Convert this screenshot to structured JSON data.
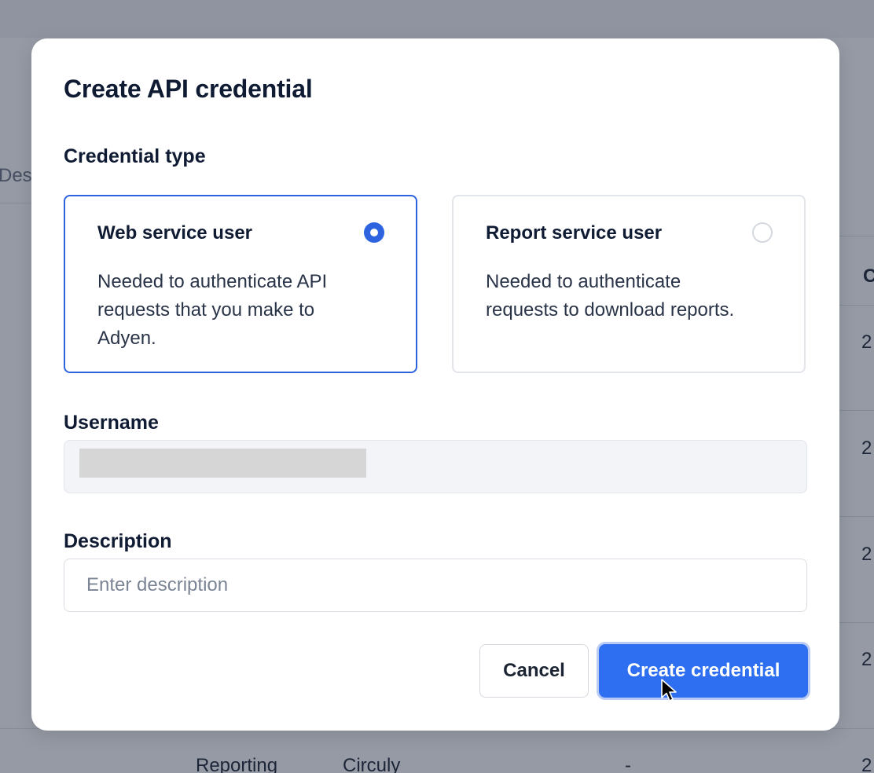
{
  "background": {
    "fragments": {
      "description_col": "Descriptio",
      "col_header": "C",
      "row_dates": [
        "2",
        "2",
        "2",
        "2",
        "2"
      ],
      "last_row_type": "Reporting",
      "last_row_company": "Circuly",
      "last_row_dash": "-"
    }
  },
  "modal": {
    "title": "Create API credential",
    "credential_type_label": "Credential type",
    "options": [
      {
        "title": "Web service user",
        "description": "Needed to authenticate API requests that you make to Adyen.",
        "selected": true
      },
      {
        "title": "Report service user",
        "description": "Needed to authenticate requests to download reports.",
        "selected": false
      }
    ],
    "username": {
      "label": "Username",
      "value_redacted": true
    },
    "description": {
      "label": "Description",
      "value": "",
      "placeholder": "Enter description"
    },
    "buttons": {
      "cancel": "Cancel",
      "create": "Create credential"
    }
  },
  "colors": {
    "primary": "#2e6ef0",
    "selected_border": "#2e63df",
    "overlay": "rgba(30,40,62,0.47)"
  },
  "icons": {
    "cursor": "mouse-pointer-icon",
    "radio_checked": "radio-checked-icon",
    "radio_unchecked": "radio-unchecked-icon"
  }
}
